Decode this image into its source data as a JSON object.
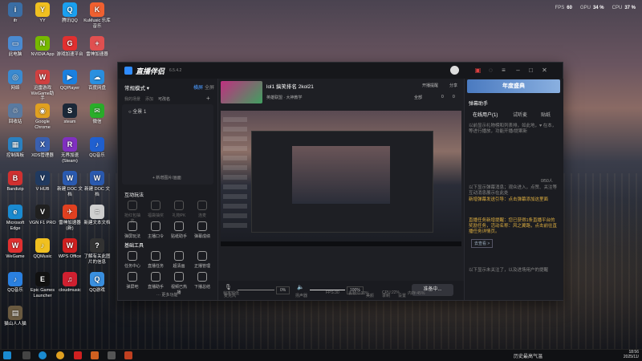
{
  "perf": {
    "fps_label": "FPS",
    "fps": "60",
    "gpu_label": "GPU",
    "gpu": "34 %",
    "cpu_label": "CPU",
    "cpu": "37 %"
  },
  "desktop": [
    {
      "label": "ifr",
      "color": "#3a6ea5",
      "glyph": "i"
    },
    {
      "label": "YY",
      "color": "#f0c020",
      "glyph": "Y"
    },
    {
      "label": "腾讯QQ",
      "color": "#1aa0f0",
      "glyph": "Q"
    },
    {
      "label": "KuMusic 乐库音乐",
      "color": "#f06030",
      "glyph": "K"
    },
    {
      "label": "此电脑",
      "color": "#4a8ad0",
      "glyph": "▭"
    },
    {
      "label": "NVIDIA App",
      "color": "#76b900",
      "glyph": "N"
    },
    {
      "label": "游戏加速平台",
      "color": "#e03030",
      "glyph": "G"
    },
    {
      "label": "雷神加速器",
      "color": "#e05050",
      "glyph": "+"
    },
    {
      "label": "网络",
      "color": "#3a8ad0",
      "glyph": "◎"
    },
    {
      "label": "迅雷游戏 WeGame助手",
      "color": "#d04040",
      "glyph": "W"
    },
    {
      "label": "QQPlayer",
      "color": "#1a80e0",
      "glyph": "▶"
    },
    {
      "label": "百度网盘",
      "color": "#2a90e0",
      "glyph": "☁"
    },
    {
      "label": "回收站",
      "color": "#5a7aa0",
      "glyph": "♲"
    },
    {
      "label": "Google Chrome",
      "color": "#e0a020",
      "glyph": "◉"
    },
    {
      "label": "steam",
      "color": "#1b2838",
      "glyph": "S"
    },
    {
      "label": "微信",
      "color": "#2aae2a",
      "glyph": "✉"
    },
    {
      "label": "控制面板",
      "color": "#2a80c0",
      "glyph": "▦"
    },
    {
      "label": "XDS管理器",
      "color": "#3a60b0",
      "glyph": "X"
    },
    {
      "label": "无界加速(Steam)",
      "color": "#8030c0",
      "glyph": "R"
    },
    {
      "label": "QQ音乐",
      "color": "#2060d0",
      "glyph": "♪"
    },
    {
      "label": "Bandizip",
      "color": "#d03030",
      "glyph": "B"
    },
    {
      "label": "V HUB",
      "color": "#203a60",
      "glyph": "V"
    },
    {
      "label": "新建 DOC 文档",
      "color": "#2a5ab0",
      "glyph": "W"
    },
    {
      "label": "新建 DOC 文档",
      "color": "#2a5ab0",
      "glyph": "W"
    },
    {
      "label": "Microsoft Edge",
      "color": "#1a8ad0",
      "glyph": "e"
    },
    {
      "label": "VGN F1 PRO",
      "color": "#202020",
      "glyph": "V"
    },
    {
      "label": "雷神加速器(新)",
      "color": "#e04020",
      "glyph": "✈"
    },
    {
      "label": "新建文本文档",
      "color": "#d0d0d0",
      "glyph": "≡"
    },
    {
      "label": "WeGame",
      "color": "#e03030",
      "glyph": "W"
    },
    {
      "label": "QQMusic",
      "color": "#f0c020",
      "glyph": "♪"
    },
    {
      "label": "WPS Office",
      "color": "#d02020",
      "glyph": "W"
    },
    {
      "label": "了解有关此图片的信息",
      "color": "#333",
      "glyph": "?"
    },
    {
      "label": "QQ音乐",
      "color": "#2a80e0",
      "glyph": "♪"
    },
    {
      "label": "Epic Games Launcher",
      "color": "#111",
      "glyph": "E"
    },
    {
      "label": "cloudmusic",
      "color": "#d02030",
      "glyph": "♫"
    },
    {
      "label": "QQ游戏",
      "color": "#3a90e0",
      "glyph": "Q"
    },
    {
      "label": "猫山人人猫",
      "color": "#6a5a40",
      "glyph": "▤"
    }
  ],
  "app": {
    "name": "直播伴侣",
    "version": "6.5.4.2",
    "scene_mode": "常规模式 ▾",
    "tab_landscape": "横屏",
    "tab_all": "全屏",
    "tabs_small": [
      "我的场景",
      "添加",
      "可改名"
    ],
    "scene_item": "○ 全景 1",
    "add_scene": "+ 新增图片/画面",
    "interactive_title": "互动玩法",
    "interactive": [
      "抢红包抽奖",
      "福袋抽奖",
      "礼物PK",
      "连麦",
      "弹屏玩法",
      "主播口令",
      "贴纸助手",
      "弹幕成绩"
    ],
    "basic_tools_title": "基础工具",
    "basic_tools": [
      "任务中心",
      "直播任务",
      "超清画",
      "正播管理",
      "弹屏吧",
      "直播助手",
      "视频已热播",
      "下播总结"
    ],
    "more_features": "··· 更多功能",
    "stream_title": "lol1 搞笑排名 2kol21",
    "stream_tags": "英雄联盟 · 大神教学",
    "top_actions": [
      "开播提醒",
      "分享"
    ],
    "mid_actions": [
      "全部",
      "0",
      "0"
    ],
    "announce_banner": "年度盛典",
    "right_title": "弹幕助手",
    "right_tabs": [
      "在线用户(1)",
      "试听麦",
      "贴纸"
    ],
    "right_text_1": "以前显示礼物榜和列表排，如此地，♥ 在本，等进行播放，功能开播/提案新",
    "counter": "0/50人",
    "right_text_2": "以下显示弹幕消息；观众进入，点赞、关注等互动消息展示在此处",
    "notice_1": "新增弹幕发送引导：点击弹幕添加这里面",
    "notice_2": "直播任务新增提醒：您已获得1条直播平台的奖励任务，活动名称：风之翼路，点击前往直播任务详情页。",
    "notice_link": "去查看 >",
    "right_text_3": "以下显示未关注了，以及进场用户的提醒",
    "mic_label": "麦克风",
    "mic_val": "0%",
    "speaker_label": "扬声器",
    "speaker_val": "100%",
    "ctrl_buttons": [
      "美颜",
      "录制",
      "设置"
    ],
    "go_live": "准备中...",
    "status": [
      "帧率较低",
      "FPS:30",
      "丢帧:0.00%",
      "CPU:22%",
      "内存:45%"
    ]
  },
  "taskbar": {
    "weather": "历史最高气温",
    "time": "18:56",
    "date": "2025/11/"
  }
}
